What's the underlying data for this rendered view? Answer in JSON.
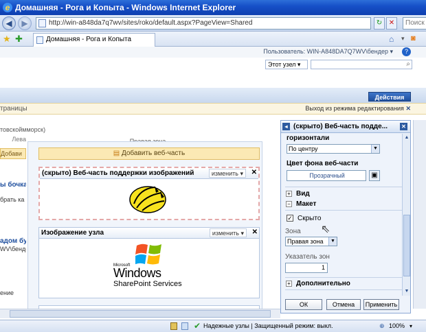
{
  "window": {
    "title": "Домашняя - Рога и Копыта - Windows Internet Explorer"
  },
  "addressbar": {
    "url": "http://win-a848da7q7wv/sites/roko/default.aspx?PageView=Shared",
    "search_placeholder": "Поиск"
  },
  "tab": {
    "label": "Домашняя - Рога и Копыта"
  },
  "header": {
    "user_label": "Пользователь: WIN-A848DA7Q7WV\\бендер ▾",
    "scope": "Этот узел",
    "actions": "Действия узла ▾"
  },
  "editbar": {
    "left": "траницы",
    "exit": "Выход из режима редактирования"
  },
  "crumb": "товскоймморск)",
  "zones": {
    "left_label": "Лева",
    "right_label": "Правая зона",
    "left_add": "Добави",
    "add_webpart": "Добавить веб-часть"
  },
  "left_items": [
    "ы бочка:",
    "брать ка",
    "адом бу",
    "WV\\бенде",
    "ение"
  ],
  "webparts": [
    {
      "title": "(скрыто) Веб-часть поддержки изображений",
      "edit": "изменить ▾"
    },
    {
      "title": "Изображение узла",
      "edit": "изменить ▾"
    }
  ],
  "logo": {
    "ms": "Microsoft",
    "windows": "Windows",
    "sps": "SharePoint Services"
  },
  "toolpane": {
    "title": "(скрыто) Веб-часть подде...",
    "h_align_label": "горизонтали",
    "h_align_value": "По центру",
    "bg_label": "Цвет фона веб-части",
    "bg_value": "Прозрачный",
    "sec_view": "Вид",
    "sec_layout": "Макет",
    "hidden_label": "Скрыто",
    "zone_label": "Зона",
    "zone_value": "Правая зона",
    "zone_index_label": "Указатель зон",
    "zone_index_value": "1",
    "sec_advanced": "Дополнительно",
    "ok": "ОК",
    "cancel": "Отмена",
    "apply": "Применить"
  },
  "statusbar": {
    "trusted": "Надежные узлы | Защищенный режим: выкл.",
    "zoom": "100%"
  }
}
